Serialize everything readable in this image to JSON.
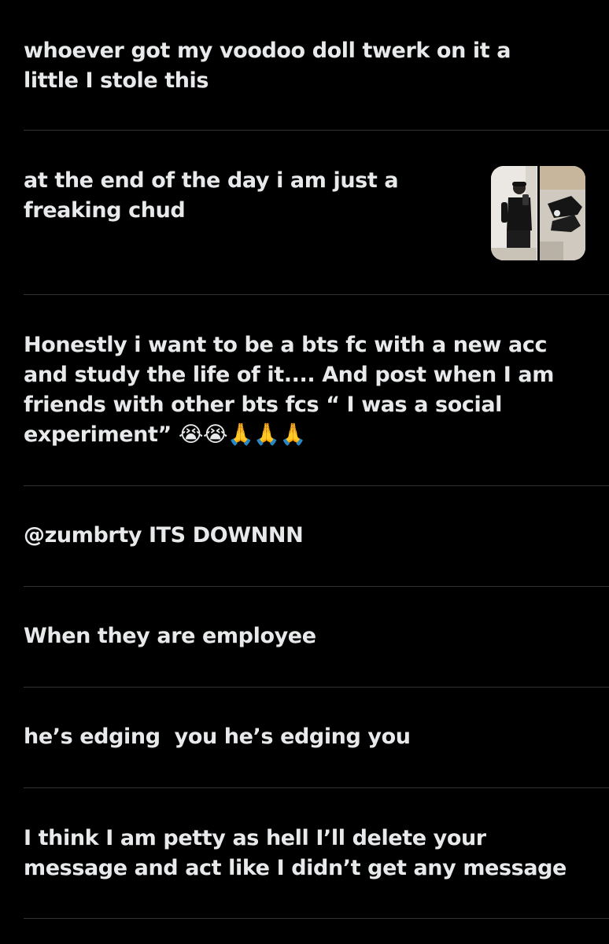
{
  "posts": [
    {
      "text": "whoever got my voodoo doll twerk on it a\nlittle I stole this"
    },
    {
      "text": "at the end of the day i am just a\nfreaking chud",
      "has_media": true
    },
    {
      "text": "Honestly i want to be a bts fc with a new acc\nand study the life of it.... And post when I am\nfriends with other bts fcs “ I was a social\nexperiment” 😭😭🙏🙏🙏"
    },
    {
      "text": "@zumbrty ITS DOWNNN"
    },
    {
      "text": "When they are employee"
    },
    {
      "text": "he’s edging  you he’s edging you"
    },
    {
      "text": "I think I am petty as hell I’ll delete your\nmessage and act like I didn’t get any message"
    }
  ],
  "colors": {
    "background": "#000000",
    "text": "#e7e9ea",
    "divider": "#2f3336"
  }
}
